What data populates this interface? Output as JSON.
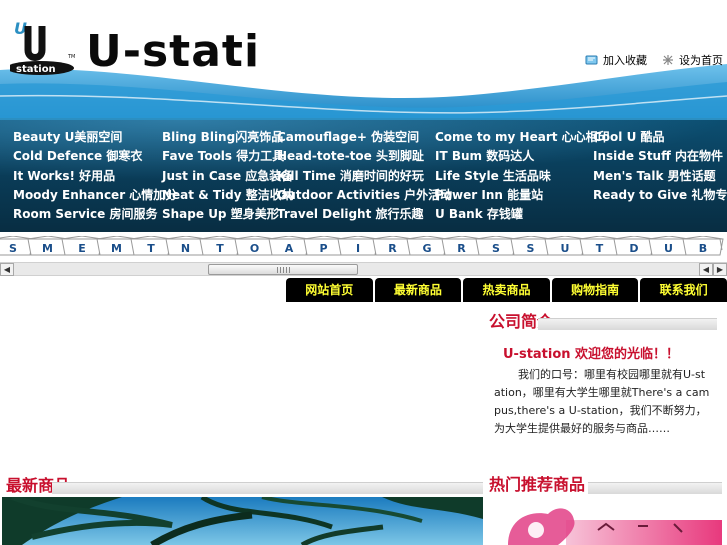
{
  "header": {
    "title": "U-stati",
    "logo_text": "station",
    "logo_letter": "U",
    "toplinks": [
      {
        "label": "加入收藏",
        "icon": "bookmark-icon"
      },
      {
        "label": "设为首页",
        "icon": "home-sparkle-icon"
      }
    ]
  },
  "categories": [
    [
      "Beauty U美丽空间",
      "Bling Bling闪亮饰品",
      "Camouflage+ 伪装空间",
      "Come to my Heart 心心相印",
      "Cool U 酷品"
    ],
    [
      "Cold Defence 御寒衣",
      "Fave Tools 得力工具",
      "Head-tote-toe 头到脚趾",
      "IT Bum 数码达人",
      "Inside Stuff 内在物件"
    ],
    [
      "It Works! 好用品",
      "Just in Case 应急装备",
      "Kill Time 消磨时间的好玩",
      "Life Style 生活品味",
      "Men's Talk 男性话题"
    ],
    [
      "Moody Enhancer 心情加分",
      "Neat & Tidy 整洁收纳",
      "Outdoor Activities 户外活动",
      "Power Inn 能量站",
      "Ready to Give 礼物专区"
    ],
    [
      "Room Service 房间服务",
      "Shape Up 塑身美形",
      "Travel Delight 旅行乐趣",
      "U Bank 存钱罐",
      ""
    ]
  ],
  "letters": [
    "S",
    "M",
    "E",
    "M",
    "T",
    "N",
    "T",
    "O",
    "A",
    "P",
    "I",
    "R",
    "G",
    "R",
    "S",
    "S",
    "U",
    "T",
    "D",
    "U",
    "B"
  ],
  "blacknav": [
    "网站首页",
    "最新商品",
    "热卖商品",
    "购物指南",
    "联系我们"
  ],
  "intro": {
    "heading": "公司简介",
    "title": "U-station 欢迎您的光临！！",
    "text": "我们的口号：哪里有校园哪里就有U-station，哪里有大学生哪里就There's a campus,there's a U-station，我们不断努力，为大学生提供最好的服务与商品……"
  },
  "sections": {
    "left_heading": "最新商品",
    "right_heading": "热门推荐商品"
  },
  "colors": {
    "menu_bg": "#0a3f5c",
    "accent_red": "#c8102e",
    "nav_text": "#ffff33"
  }
}
